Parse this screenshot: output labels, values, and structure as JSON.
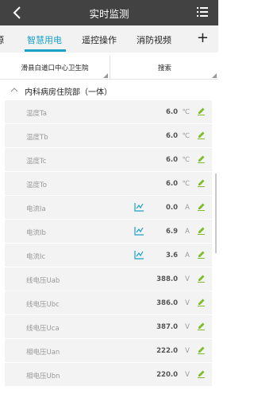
{
  "header": {
    "title": "实时监测"
  },
  "tabs": [
    {
      "label": "源",
      "active": false
    },
    {
      "label": "智慧用电",
      "active": true
    },
    {
      "label": "遥控操作",
      "active": false
    },
    {
      "label": "消防视频",
      "active": false
    }
  ],
  "tabs_add": "+",
  "filter": {
    "station": "滑县白道口中心卫生院",
    "search": "搜索"
  },
  "group": {
    "label": "内科病房住院部（一体）"
  },
  "rows": [
    {
      "name": "温度Ta",
      "value": "6.0",
      "unit": "℃",
      "has_chart": false
    },
    {
      "name": "温度Tb",
      "value": "6.0",
      "unit": "℃",
      "has_chart": false
    },
    {
      "name": "温度Tc",
      "value": "6.0",
      "unit": "℃",
      "has_chart": false
    },
    {
      "name": "温度To",
      "value": "6.0",
      "unit": "℃",
      "has_chart": false
    },
    {
      "name": "电流Ia",
      "value": "0.0",
      "unit": "A",
      "has_chart": true
    },
    {
      "name": "电流Ib",
      "value": "6.9",
      "unit": "A",
      "has_chart": true
    },
    {
      "name": "电流Ic",
      "value": "3.6",
      "unit": "A",
      "has_chart": true
    },
    {
      "name": "线电压Uab",
      "value": "388.0",
      "unit": "V",
      "has_chart": false
    },
    {
      "name": "线电压Ubc",
      "value": "386.0",
      "unit": "V",
      "has_chart": false
    },
    {
      "name": "线电压Uca",
      "value": "387.0",
      "unit": "V",
      "has_chart": false
    },
    {
      "name": "相电压Uan",
      "value": "222.0",
      "unit": "V",
      "has_chart": false
    },
    {
      "name": "相电压Ubn",
      "value": "220.0",
      "unit": "V",
      "has_chart": false
    }
  ],
  "colors": {
    "accent": "#1aa1c9",
    "edit_icon": "#7cbf2a",
    "header_bg": "#424242"
  },
  "icons": {
    "back": "back-chevron-icon",
    "menu": "list-menu-icon",
    "chart": "trend-chart-icon",
    "edit": "pencil-icon"
  }
}
